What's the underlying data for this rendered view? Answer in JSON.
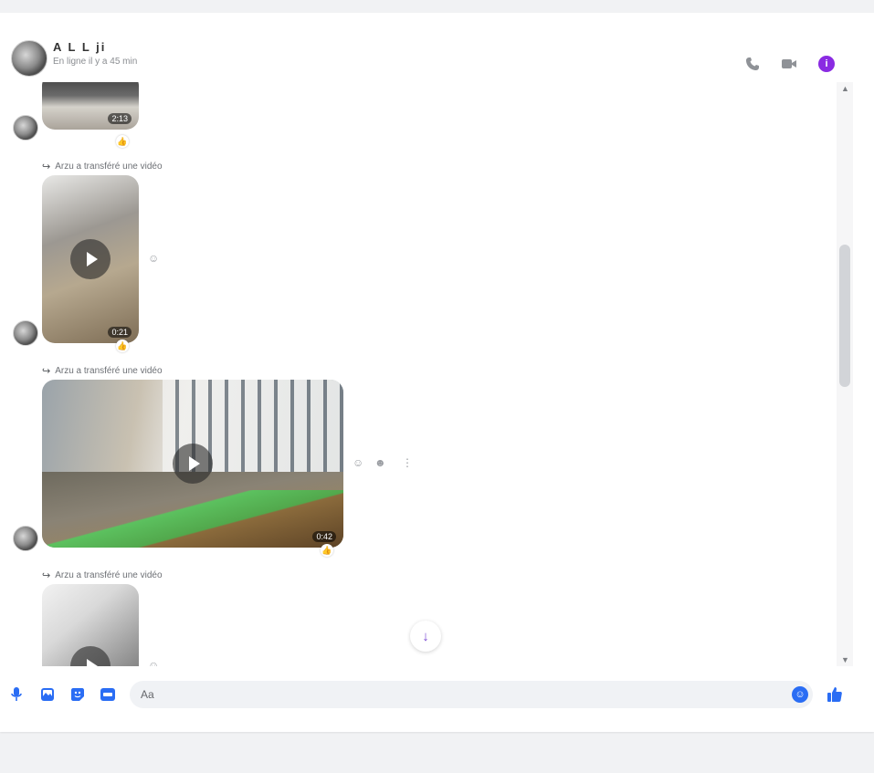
{
  "header": {
    "contact_name": "A L L  ji",
    "contact_status": "En ligne il y a 45 min",
    "icons": {
      "call": "phone-icon",
      "video": "video-camera-icon",
      "info": "info-icon"
    },
    "info_glyph": "i"
  },
  "messages": [
    {
      "type": "video",
      "duration": "2:13",
      "reaction": "👍",
      "forward_label": ""
    },
    {
      "type": "video",
      "duration": "0:21",
      "reaction": "👍",
      "forward_label": "Arzu a transféré une vidéo"
    },
    {
      "type": "video",
      "duration": "0:42",
      "reaction": "👍",
      "forward_label": "Arzu a transféré une vidéo"
    },
    {
      "type": "video",
      "duration": "",
      "reaction": "",
      "forward_label": "Arzu a transféré une vidéo"
    }
  ],
  "composer": {
    "placeholder": "Aa",
    "icons": [
      "microphone-icon",
      "image-icon",
      "sticker-icon",
      "gif-icon",
      "emoji-icon",
      "thumbs-up-icon"
    ]
  },
  "colors": {
    "accent": "#2a6df4",
    "info_purple": "#8a2be2",
    "scroll_button": "#7b49d3"
  }
}
